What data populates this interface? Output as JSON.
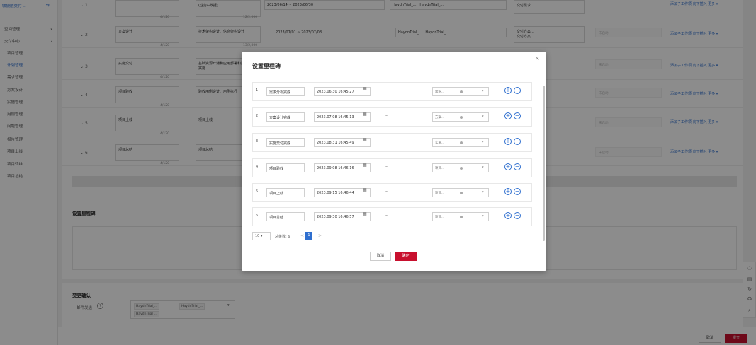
{
  "sidebar": {
    "logo": "敏捷融交付 ...",
    "link_icon": "link-icon",
    "items": [
      {
        "label": "空间管理",
        "caret": "▾"
      },
      {
        "label": "交付中心",
        "caret": "▴"
      },
      {
        "label": "项目管理"
      },
      {
        "label": "计划管理"
      },
      {
        "label": "需求管理"
      },
      {
        "label": "方案设计"
      },
      {
        "label": "实施管理"
      },
      {
        "label": "用例管理"
      },
      {
        "label": "问题管理"
      },
      {
        "label": "报告管理"
      },
      {
        "label": "项目上线"
      },
      {
        "label": "项目转维"
      },
      {
        "label": "项目总结"
      }
    ]
  },
  "plan_rows": [
    {
      "idx": "1",
      "name": "",
      "count1": "4/120",
      "desc": "(业务&数据)",
      "count2": "12/2,000",
      "date": "2023/06/14 ~ 2023/06/30",
      "owners": [
        "HaydnTrial_...",
        "HaydnTrial_..."
      ],
      "deliv": [
        "交付需求..."
      ]
    },
    {
      "idx": "2",
      "name": "方案设计",
      "count1": "4/120",
      "desc": "技术架构设计、信息架构设计",
      "count2": "13/2,000",
      "date": "2023/07/01 ~ 2023/07/08",
      "owners": [
        "HaydnTrial_...",
        "HaydnTrial_..."
      ],
      "deliv": [
        "交付方案...",
        "交付方案..."
      ]
    },
    {
      "idx": "3",
      "name": "实施交付",
      "count1": "4/120",
      "desc": "基础资源开通和应用部署和数据治理实施"
    },
    {
      "idx": "4",
      "name": "项目验收",
      "count1": "4/120",
      "desc": "验收用例设计、用例执行"
    },
    {
      "idx": "5",
      "name": "项目上线",
      "count1": "4/120",
      "desc": "项目上线"
    },
    {
      "idx": "6",
      "name": "项目总结",
      "count1": "4/120",
      "desc": "项目总结"
    }
  ],
  "row_status": "未启动",
  "row_links": "添加子工作项  向下插入  更多 ▾",
  "milestone_section": {
    "title": "设置里程碑"
  },
  "change_confirm": {
    "title": "变更确认",
    "label": "邮件发送",
    "tags": [
      "HaydnTrial_...",
      "HaydnTrial_...",
      "HaydnTrial_..."
    ]
  },
  "footer": {
    "cancel": "取消",
    "submit": "提交"
  },
  "modal": {
    "title": "设置里程碑",
    "close": "×",
    "rows": [
      {
        "idx": "1",
        "name": "需求分析完成",
        "date": "2023.06.30 16:45:27",
        "owner": "需求..."
      },
      {
        "idx": "2",
        "name": "方案设计完成",
        "date": "2023.07.08 16:45:13",
        "owner": "方案..."
      },
      {
        "idx": "3",
        "name": "实施交付完成",
        "date": "2023.08.31 16:45:49",
        "owner": "实施..."
      },
      {
        "idx": "4",
        "name": "项目验收",
        "date": "2023.09.08 16:46:16",
        "owner": "项目..."
      },
      {
        "idx": "5",
        "name": "项目上线",
        "date": "2023.09.15 16:46:44",
        "owner": "项目..."
      },
      {
        "idx": "6",
        "name": "项目总结",
        "date": "2023.09.30 16:46:57",
        "owner": "项目..."
      }
    ],
    "dash": "–",
    "pager": {
      "size": "10 ▾",
      "total": "总条数: 6",
      "prev": "<",
      "page": "1",
      "next": ">"
    },
    "cancel": "取消",
    "ok": "确定"
  },
  "colors": {
    "accent": "#2f6fcf",
    "primary_button": "#c8102e"
  }
}
